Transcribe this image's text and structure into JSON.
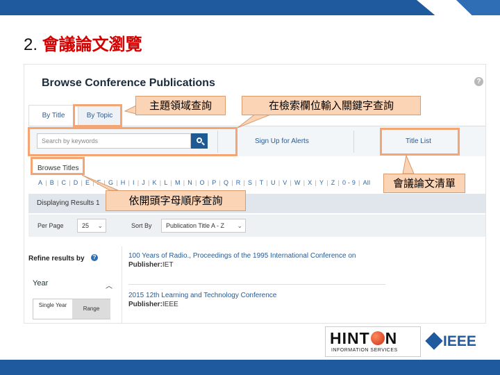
{
  "slide": {
    "number_label": "2.",
    "title": "會議論文瀏覽"
  },
  "page": {
    "heading": "Browse Conference Publications",
    "help_icon_glyph": "?"
  },
  "tabs": [
    {
      "label": "By Title",
      "active": true
    },
    {
      "label": "By Topic",
      "active": false
    }
  ],
  "search": {
    "placeholder": "Search by keywords",
    "button_icon": "search-icon"
  },
  "links": {
    "alerts": "Sign Up for Alerts",
    "title_list": "Title List"
  },
  "browse": {
    "label": "Browse Titles",
    "alphabet": [
      "A",
      "B",
      "C",
      "D",
      "E",
      "F",
      "G",
      "H",
      "I",
      "J",
      "K",
      "L",
      "M",
      "N",
      "O",
      "P",
      "Q",
      "R",
      "S",
      "T",
      "U",
      "V",
      "W",
      "X",
      "Y",
      "Z",
      "0 - 9",
      "All"
    ]
  },
  "display": {
    "text": "Displaying Results 1"
  },
  "controls": {
    "per_page_label": "Per Page",
    "per_page_value": "25",
    "sort_label": "Sort By",
    "sort_value": "Publication Title A - Z"
  },
  "refine": {
    "title": "Refine results by",
    "year_label": "Year",
    "single_year": "Single Year",
    "range": "Range"
  },
  "results": [
    {
      "title": "100 Years of Radio., Proceedings of the 1995 International Conference on",
      "publisher_label": "Publisher:",
      "publisher": "IET"
    },
    {
      "title": "2015 12th Learning and Technology Conference",
      "publisher_label": "Publisher:",
      "publisher": "IEEE"
    }
  ],
  "callouts": {
    "topic": "主題領域查詢",
    "keyword": "在檢索欄位輸入關鍵字查詢",
    "title_list": "會議論文清單",
    "alpha": "依開頭字母順序查詢"
  },
  "logos": {
    "hinton_word_left": "HINT",
    "hinton_word_right": "N",
    "hinton_sub": "INFORMATION SERVICES",
    "ieee": "IEEE"
  },
  "colors": {
    "brand_blue": "#1f5a9e",
    "title_red": "#d40000",
    "callout_fill": "#fbd4b6",
    "highlight_border": "#f4a574"
  }
}
